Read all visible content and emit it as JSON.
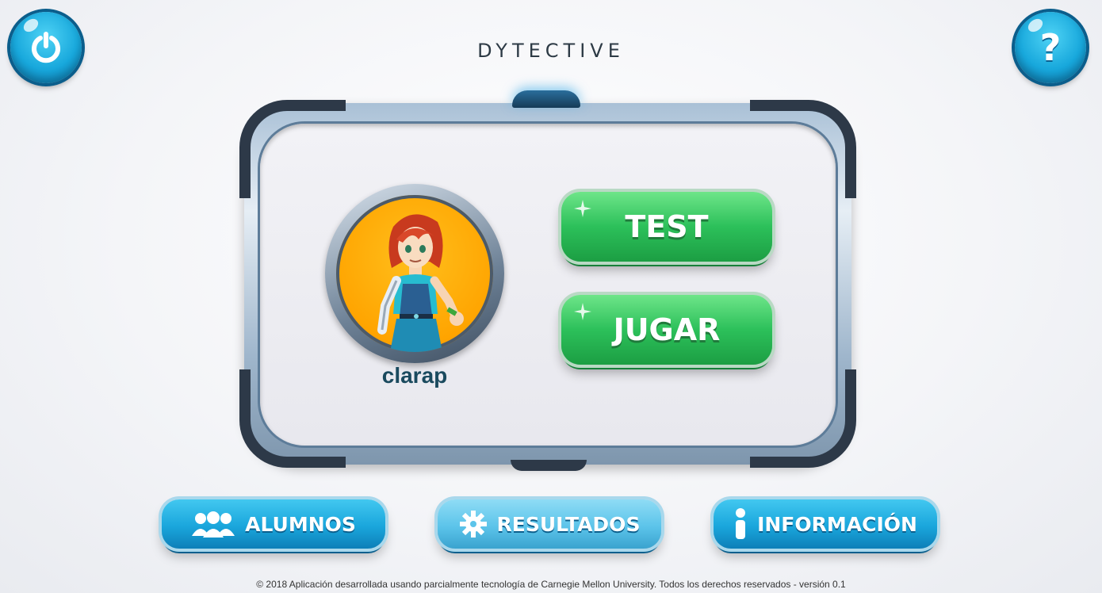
{
  "header": {
    "logo_text": "DYTECTIVE",
    "power_icon": "power-icon",
    "help_label": "?"
  },
  "profile": {
    "username": "clarap",
    "avatar_icon": "girl-character-avatar"
  },
  "actions": {
    "test_label": "TEST",
    "jugar_label": "JUGAR"
  },
  "bottom_nav": {
    "alumnos_label": "ALUMNOS",
    "resultados_label": "RESULTADOS",
    "informacion_label": "INFORMACIÓN",
    "alumnos_icon": "users-icon",
    "resultados_icon": "gear-icon",
    "informacion_icon": "info-icon"
  },
  "footer": {
    "text": "© 2018 Aplicación desarrollada usando parcialmente tecnología de Carnegie Mellon University. Todos los derechos reservados - versión 0.1"
  },
  "colors": {
    "primary_blue": "#1aa6dc",
    "green": "#2cc05a",
    "avatar_bg": "#ffa400",
    "username": "#1a4a5e"
  }
}
